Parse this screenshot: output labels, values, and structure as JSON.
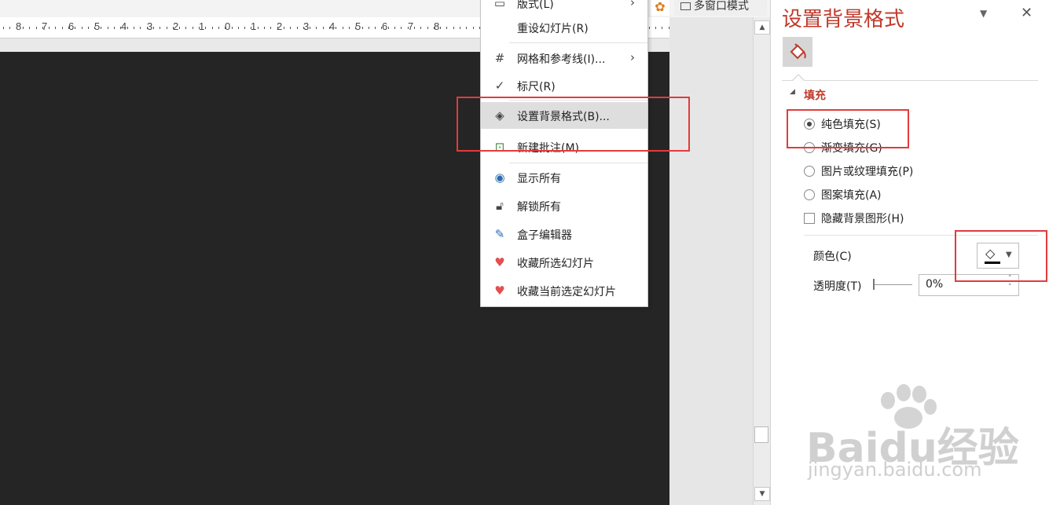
{
  "toolbar": {
    "multi_window_label": "多窗口模式"
  },
  "ruler": {
    "labels": [
      "8",
      "7",
      "6",
      "5",
      "4",
      "3",
      "2",
      "1",
      "0",
      "1",
      "2",
      "3",
      "4",
      "5",
      "6",
      "7",
      "8"
    ]
  },
  "context_menu": {
    "items": [
      {
        "label": "版式(L)",
        "icon": "layout-icon",
        "has_submenu": true
      },
      {
        "label": "重设幻灯片(R)",
        "icon": "none"
      },
      {
        "label": "网格和参考线(I)...",
        "icon": "grid-icon",
        "has_submenu": true
      },
      {
        "label": "标尺(R)",
        "icon": "check-icon",
        "checked": true
      },
      {
        "label": "设置背景格式(B)...",
        "icon": "format-background-icon",
        "highlighted": true
      },
      {
        "label": "新建批注(M)",
        "icon": "new-comment-icon"
      },
      {
        "label": "显示所有",
        "icon": "eye-icon"
      },
      {
        "label": "解锁所有",
        "icon": "unlock-icon"
      },
      {
        "label": "盒子编辑器",
        "icon": "edit-icon"
      },
      {
        "label": "收藏所选幻灯片",
        "icon": "heart-add-icon"
      },
      {
        "label": "收藏当前选定幻灯片",
        "icon": "heart-icon"
      }
    ]
  },
  "panel": {
    "title": "设置背景格式",
    "section_fill": "填充",
    "options": [
      {
        "label": "纯色填充(S)",
        "type": "radio",
        "selected": true
      },
      {
        "label": "渐变填充(G)",
        "type": "radio",
        "selected": false
      },
      {
        "label": "图片或纹理填充(P)",
        "type": "radio",
        "selected": false
      },
      {
        "label": "图案填充(A)",
        "type": "radio",
        "selected": false
      },
      {
        "label": "隐藏背景图形(H)",
        "type": "checkbox",
        "checked": false
      }
    ],
    "color_label": "颜色(C)",
    "color_value": "#000000",
    "transparency_label": "透明度(T)",
    "transparency_value": "0%"
  },
  "watermark": {
    "brand": "Baidu经验",
    "url": "jingyan.baidu.com"
  },
  "colors": {
    "accent": "#c0392b",
    "highlight_box": "#e23b3b",
    "slide_bg": "#252525"
  }
}
